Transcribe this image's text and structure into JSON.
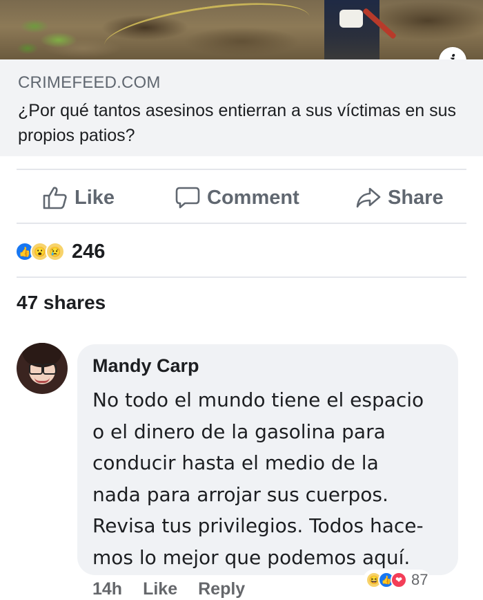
{
  "post": {
    "link_domain": "CRIMEFEED.COM",
    "link_title": "¿Por qué tantos asesinos entierran a sus víctimas en sus propios patios?",
    "info_icon": "i"
  },
  "actions": {
    "like_label": "Like",
    "comment_label": "Comment",
    "share_label": "Share"
  },
  "reactions": {
    "icons": [
      "like-icon",
      "wow-icon",
      "sad-icon"
    ],
    "count": "246"
  },
  "shares": "47 shares",
  "comment": {
    "author": "Mandy Carp",
    "text": "No todo el mundo tiene el espacio\no el dinero de la gasolina para\nconducir hasta el medio de la\nnada para arrojar sus cuerpos.\nRevisa tus privilegios. Todos hace-\nmos lo mejor que podemos aquí.",
    "time": "14h",
    "like_label": "Like",
    "reply_label": "Reply",
    "reaction_icons": [
      "haha-icon",
      "like-icon",
      "love-icon"
    ],
    "reaction_count": "87"
  },
  "colors": {
    "facebook_blue": "#1877f2",
    "gray_text": "#606770",
    "bubble_bg": "#f0f2f5",
    "link_bg": "#f2f3f5"
  }
}
